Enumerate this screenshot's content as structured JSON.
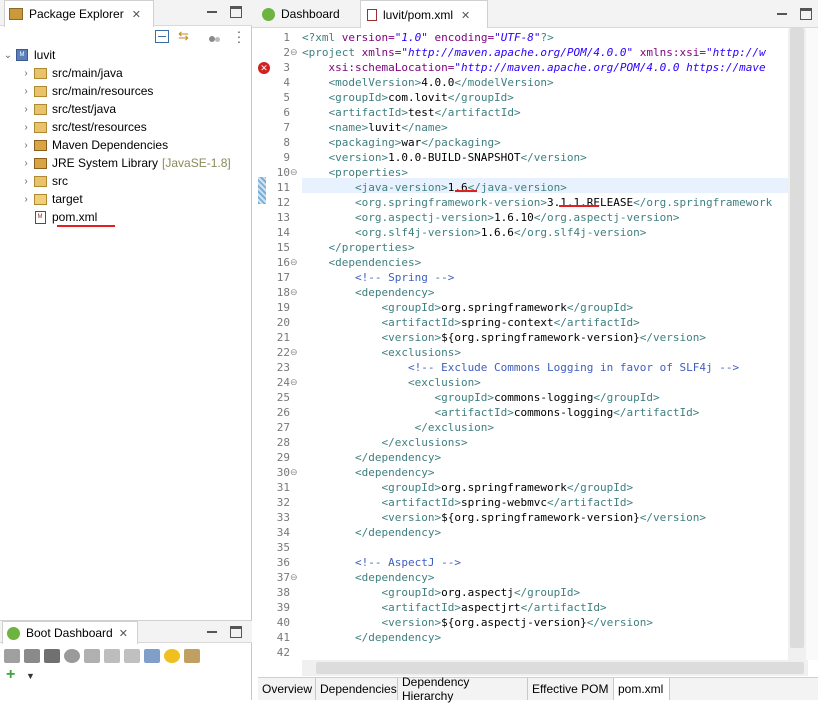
{
  "package_explorer": {
    "title": "Package Explorer",
    "close": "✕",
    "tree": [
      {
        "label": "luvit",
        "icon": "maven-project-icon"
      },
      {
        "label": "src/main/java",
        "icon": "package-folder-icon"
      },
      {
        "label": "src/main/resources",
        "icon": "package-folder-icon"
      },
      {
        "label": "src/test/java",
        "icon": "package-folder-icon"
      },
      {
        "label": "src/test/resources",
        "icon": "package-folder-icon"
      },
      {
        "label": "Maven Dependencies",
        "icon": "library-icon"
      },
      {
        "label": "JRE System Library",
        "decoration": "[JavaSE-1.8]",
        "icon": "library-icon"
      },
      {
        "label": "src",
        "icon": "source-folder-icon"
      },
      {
        "label": "target",
        "icon": "folder-icon"
      },
      {
        "label": "pom.xml",
        "icon": "xml-file-icon"
      }
    ]
  },
  "boot_dashboard": {
    "title": "Boot Dashboard",
    "close": "✕"
  },
  "editor_tabs": [
    {
      "label": "Dashboard"
    },
    {
      "label": "luvit/pom.xml",
      "close": "✕"
    }
  ],
  "bottom_tabs": [
    "Overview",
    "Dependencies",
    "Dependency Hierarchy",
    "Effective POM",
    "pom.xml"
  ],
  "line_numbers": [
    "1",
    "2",
    "3",
    "4",
    "5",
    "6",
    "7",
    "8",
    "9",
    "10",
    "11",
    "12",
    "13",
    "14",
    "15",
    "16",
    "17",
    "18",
    "19",
    "20",
    "21",
    "22",
    "23",
    "24",
    "25",
    "26",
    "27",
    "28",
    "29",
    "30",
    "31",
    "32",
    "33",
    "34",
    "35",
    "36",
    "37",
    "38",
    "39",
    "40",
    "41",
    "42"
  ],
  "code": [
    [
      {
        "t": "<?",
        "c": "tg"
      },
      {
        "t": "xml ",
        "c": "tg"
      },
      {
        "t": "version=",
        "c": "at"
      },
      {
        "t": "\"1.0\"",
        "c": "av"
      },
      {
        "t": " encoding=",
        "c": "at"
      },
      {
        "t": "\"UTF-8\"",
        "c": "av"
      },
      {
        "t": "?>",
        "c": "tg"
      }
    ],
    [
      {
        "t": "<project ",
        "c": "tg"
      },
      {
        "t": "xmlns=",
        "c": "at"
      },
      {
        "t": "\"http://maven.apache.org/POM/4.0.0\"",
        "c": "av"
      },
      {
        "t": " xmlns:xsi=",
        "c": "at"
      },
      {
        "t": "\"http://w",
        "c": "av"
      }
    ],
    [
      {
        "t": "    xsi:schemaLocation=",
        "c": "at"
      },
      {
        "t": "\"http://maven.apache.org/POM/4.0.0 https://mave",
        "c": "av"
      }
    ],
    [
      {
        "t": "    <modelVersion>",
        "c": "tg"
      },
      {
        "t": "4.0.0",
        "c": "tx"
      },
      {
        "t": "</modelVersion>",
        "c": "tg"
      }
    ],
    [
      {
        "t": "    <groupId>",
        "c": "tg"
      },
      {
        "t": "com.lovit",
        "c": "tx"
      },
      {
        "t": "</groupId>",
        "c": "tg"
      }
    ],
    [
      {
        "t": "    <artifactId>",
        "c": "tg"
      },
      {
        "t": "test",
        "c": "tx"
      },
      {
        "t": "</artifactId>",
        "c": "tg"
      }
    ],
    [
      {
        "t": "    <name>",
        "c": "tg"
      },
      {
        "t": "luvit",
        "c": "tx"
      },
      {
        "t": "</name>",
        "c": "tg"
      }
    ],
    [
      {
        "t": "    <packaging>",
        "c": "tg"
      },
      {
        "t": "war",
        "c": "tx"
      },
      {
        "t": "</packaging>",
        "c": "tg"
      }
    ],
    [
      {
        "t": "    <version>",
        "c": "tg"
      },
      {
        "t": "1.0.0-BUILD-SNAPSHOT",
        "c": "tx"
      },
      {
        "t": "</version>",
        "c": "tg"
      }
    ],
    [
      {
        "t": "    <properties>",
        "c": "tg"
      }
    ],
    [
      {
        "t": "        <java-version>",
        "c": "tg"
      },
      {
        "t": "1.6",
        "c": "tx"
      },
      {
        "t": "</java-version>",
        "c": "tg"
      }
    ],
    [
      {
        "t": "        <org.springframework-version>",
        "c": "tg"
      },
      {
        "t": "3.1.1.RELEASE",
        "c": "tx"
      },
      {
        "t": "</org.springframework",
        "c": "tg"
      }
    ],
    [
      {
        "t": "        <org.aspectj-version>",
        "c": "tg"
      },
      {
        "t": "1.6.10",
        "c": "tx"
      },
      {
        "t": "</org.aspectj-version>",
        "c": "tg"
      }
    ],
    [
      {
        "t": "        <org.slf4j-version>",
        "c": "tg"
      },
      {
        "t": "1.6.6",
        "c": "tx"
      },
      {
        "t": "</org.slf4j-version>",
        "c": "tg"
      }
    ],
    [
      {
        "t": "    </properties>",
        "c": "tg"
      }
    ],
    [
      {
        "t": "    <dependencies>",
        "c": "tg"
      }
    ],
    [
      {
        "t": "        <!-- Spring -->",
        "c": "cm"
      }
    ],
    [
      {
        "t": "        <dependency>",
        "c": "tg"
      }
    ],
    [
      {
        "t": "            <groupId>",
        "c": "tg"
      },
      {
        "t": "org.springframework",
        "c": "tx"
      },
      {
        "t": "</groupId>",
        "c": "tg"
      }
    ],
    [
      {
        "t": "            <artifactId>",
        "c": "tg"
      },
      {
        "t": "spring-context",
        "c": "tx"
      },
      {
        "t": "</artifactId>",
        "c": "tg"
      }
    ],
    [
      {
        "t": "            <version>",
        "c": "tg"
      },
      {
        "t": "${org.springframework-version}",
        "c": "tx"
      },
      {
        "t": "</version>",
        "c": "tg"
      }
    ],
    [
      {
        "t": "            <exclusions>",
        "c": "tg"
      }
    ],
    [
      {
        "t": "                <!-- Exclude Commons Logging in favor of SLF4j -->",
        "c": "cm"
      }
    ],
    [
      {
        "t": "                <exclusion>",
        "c": "tg"
      }
    ],
    [
      {
        "t": "                    <groupId>",
        "c": "tg"
      },
      {
        "t": "commons-logging",
        "c": "tx"
      },
      {
        "t": "</groupId>",
        "c": "tg"
      }
    ],
    [
      {
        "t": "                    <artifactId>",
        "c": "tg"
      },
      {
        "t": "commons-logging",
        "c": "tx"
      },
      {
        "t": "</artifactId>",
        "c": "tg"
      }
    ],
    [
      {
        "t": "                 </exclusion>",
        "c": "tg"
      }
    ],
    [
      {
        "t": "            </exclusions>",
        "c": "tg"
      }
    ],
    [
      {
        "t": "        </dependency>",
        "c": "tg"
      }
    ],
    [
      {
        "t": "        <dependency>",
        "c": "tg"
      }
    ],
    [
      {
        "t": "            <groupId>",
        "c": "tg"
      },
      {
        "t": "org.springframework",
        "c": "tx"
      },
      {
        "t": "</groupId>",
        "c": "tg"
      }
    ],
    [
      {
        "t": "            <artifactId>",
        "c": "tg"
      },
      {
        "t": "spring-webmvc",
        "c": "tx"
      },
      {
        "t": "</artifactId>",
        "c": "tg"
      }
    ],
    [
      {
        "t": "            <version>",
        "c": "tg"
      },
      {
        "t": "${org.springframework-version}",
        "c": "tx"
      },
      {
        "t": "</version>",
        "c": "tg"
      }
    ],
    [
      {
        "t": "        </dependency>",
        "c": "tg"
      }
    ],
    [],
    [
      {
        "t": "        <!-- AspectJ -->",
        "c": "cm"
      }
    ],
    [
      {
        "t": "        <dependency>",
        "c": "tg"
      }
    ],
    [
      {
        "t": "            <groupId>",
        "c": "tg"
      },
      {
        "t": "org.aspectj",
        "c": "tx"
      },
      {
        "t": "</groupId>",
        "c": "tg"
      }
    ],
    [
      {
        "t": "            <artifactId>",
        "c": "tg"
      },
      {
        "t": "aspectjrt",
        "c": "tx"
      },
      {
        "t": "</artifactId>",
        "c": "tg"
      }
    ],
    [
      {
        "t": "            <version>",
        "c": "tg"
      },
      {
        "t": "${org.aspectj-version}",
        "c": "tx"
      },
      {
        "t": "</version>",
        "c": "tg"
      }
    ],
    [
      {
        "t": "        </dependency>",
        "c": "tg"
      }
    ],
    []
  ],
  "colors": {
    "tag": "#3f7f7f",
    "attr": "#7f007f",
    "value": "#2a00ff",
    "comment": "#3f5fbf",
    "highlight": "#e0201e",
    "current_line": "#e8f2fe"
  }
}
